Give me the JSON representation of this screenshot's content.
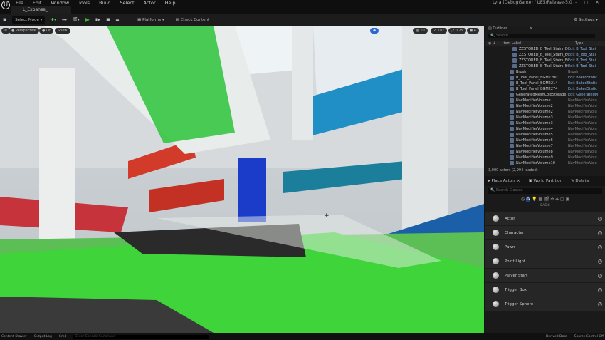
{
  "menubar": {
    "items": [
      "File",
      "Edit",
      "Window",
      "Tools",
      "Build",
      "Select",
      "Actor",
      "Help"
    ],
    "project_title": "Lyra (DebugGame) / UE5/Release-5.0",
    "level_tab": "L_Expanse_"
  },
  "toolbar": {
    "select_mode": "Select Mode",
    "platforms": "Platforms",
    "check_content": "Check Content",
    "settings": "Settings"
  },
  "viewport": {
    "perspective": "Perspective",
    "lit": "Lit",
    "show": "Show",
    "grid_snap": "10",
    "rot_snap": "10°",
    "scale_snap": "0.25",
    "camera_speed": "4"
  },
  "outliner": {
    "tab": "Outliner",
    "search_placeholder": "Search...",
    "col_label": "Item Label",
    "col_type": "Type",
    "rows": [
      {
        "label": "ZZSTORED_B_Tool_Stairs_BGM3",
        "type": "Edit B_Tool_Stai"
      },
      {
        "label": "ZZSTORED_B_Tool_Stairs_BGM3",
        "type": "Edit B_Tool_Stai"
      },
      {
        "label": "ZZSTORED_B_Tool_Stairs_BGM3",
        "type": "Edit B_Tool_Stai"
      },
      {
        "label": "ZZSTORED_B_Tool_Stairs_BGM3",
        "type": "Edit B_Tool_Stai"
      },
      {
        "label": "Brush",
        "type": "Brush"
      },
      {
        "label": "B_Tool_Panel_BGM2200",
        "type": "Edit BakedStatic"
      },
      {
        "label": "B_Tool_Panel_BGM2214",
        "type": "Edit BakedStatic"
      },
      {
        "label": "B_Tool_Panel_BGM2274",
        "type": "Edit BakedStatic"
      },
      {
        "label": "GeneratedMeshColdStorage",
        "type": "Edit GeneratedM"
      },
      {
        "label": "NavModifierVolume",
        "type": "NavModifierVolu"
      },
      {
        "label": "NavModifierVolume2",
        "type": "NavModifierVolu"
      },
      {
        "label": "NavModifierVolume2",
        "type": "NavModifierVolu"
      },
      {
        "label": "NavModifierVolume3",
        "type": "NavModifierVolu"
      },
      {
        "label": "NavModifierVolume3",
        "type": "NavModifierVolu"
      },
      {
        "label": "NavModifierVolume4",
        "type": "NavModifierVolu"
      },
      {
        "label": "NavModifierVolume5",
        "type": "NavModifierVolu"
      },
      {
        "label": "NavModifierVolume6",
        "type": "NavModifierVolu"
      },
      {
        "label": "NavModifierVolume7",
        "type": "NavModifierVolu"
      },
      {
        "label": "NavModifierVolume8",
        "type": "NavModifierVolu"
      },
      {
        "label": "NavModifierVolume9",
        "type": "NavModifierVolu"
      },
      {
        "label": "NavModifierVolume10",
        "type": "NavModifierVolu"
      }
    ],
    "count": "3,000 actors (2,994 loaded)"
  },
  "panel": {
    "tabs": [
      "Place Actors",
      "World Partition",
      "Details"
    ],
    "search_placeholder": "Search Classes",
    "category": "BASIC",
    "items": [
      "Actor",
      "Character",
      "Pawn",
      "Point Light",
      "Player Start",
      "Trigger Box",
      "Trigger Sphere"
    ]
  },
  "statusbar": {
    "content_drawer": "Content Drawer",
    "output_log": "Output Log",
    "cmd": "Cmd",
    "console_placeholder": "Enter Console Command",
    "derived_data": "Derived Data",
    "source_control": "Source Control Off"
  },
  "colors": {
    "accent_green": "#3bd13b",
    "link_blue": "#8ab4e0",
    "panel_bg": "#1a1a1a"
  }
}
